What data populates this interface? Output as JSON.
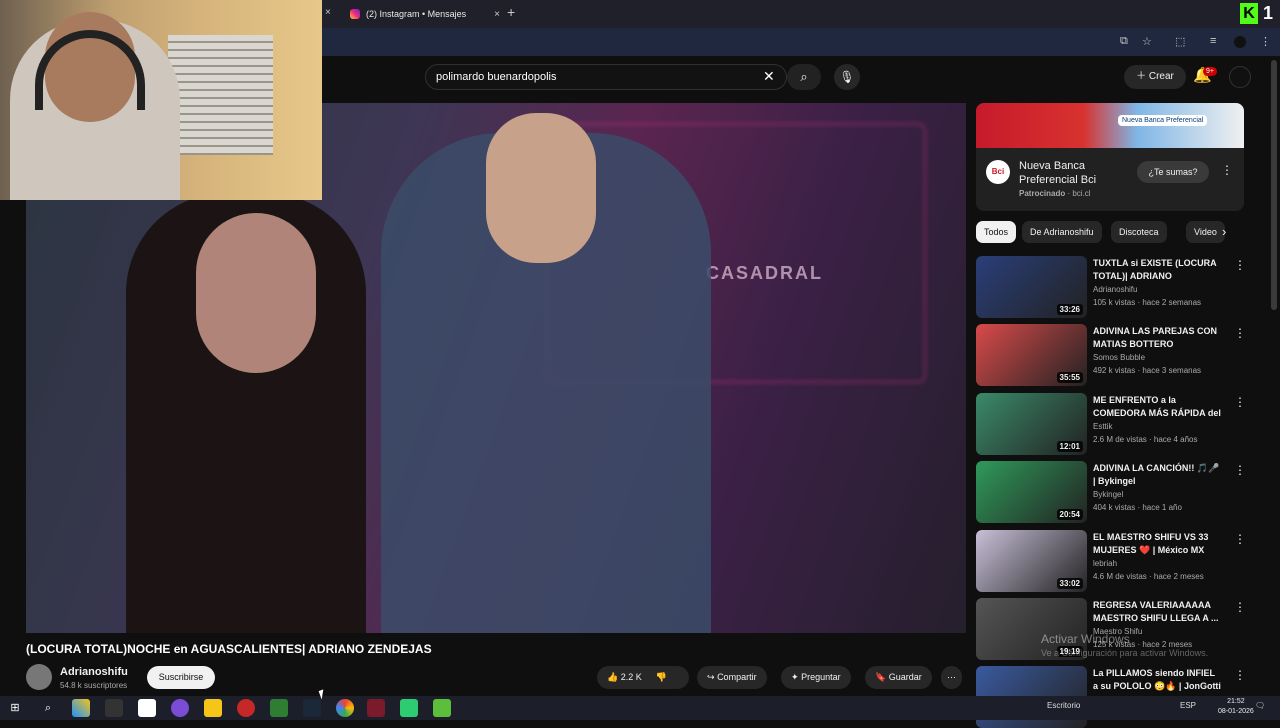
{
  "browser": {
    "tab_title": "(2) Instagram • Mensajes",
    "new_tab_symbol": "+",
    "close_symbol": "×",
    "kick_badge": "K",
    "kick_count": "1"
  },
  "youtube": {
    "search_value": "polimardo buenardopolis",
    "create_label": "Crear",
    "notifications_badge": "9+",
    "video_title": "(LOCURA TOTAL)NOCHE en AGUASCALIENTES| ADRIANO ZENDEJAS",
    "channel_name": "Adrianoshifu",
    "subscribers": "54.8 k suscriptores",
    "subscribe_label": "Suscribirse",
    "likes": "2.2 K",
    "share_label": "Compartir",
    "ask_label": "Preguntar",
    "save_label": "Guardar",
    "video_overlay_text": "CASADRAL"
  },
  "ad": {
    "title": "Nueva Banca Preferencial Bci",
    "sponsored": "Patrocinado",
    "domain": "bci.cl",
    "cta": "¿Te sumas?",
    "logo_text": "Bci",
    "image_caption": "Nueva Banca Preferencial"
  },
  "chips": [
    "Todos",
    "De Adrianoshifu",
    "Discoteca",
    "Video"
  ],
  "recommendations": [
    {
      "title": "TUXTLA si EXISTE (LOCURA TOTAL)| ADRIANO ZENDEJAS",
      "channel": "Adrianoshifu",
      "meta": "105 k vistas · hace 2 semanas",
      "duration": "33:26",
      "color": "#2a3f7a"
    },
    {
      "title": "ADIVINA LAS PAREJAS CON MATIAS BOTTERO",
      "channel": "Somos Bubble",
      "meta": "492 k vistas · hace 3 semanas",
      "duration": "35:55",
      "color": "#d94a4a"
    },
    {
      "title": "ME ENFRENTO a la COMEDORA MÁS RÁPIDA del MUNDO (ELL...",
      "channel": "Esttik",
      "meta": "2.6 M de vistas · hace 4 años",
      "duration": "12:01",
      "color": "#3a8a6a"
    },
    {
      "title": "ADIVINA LA CANCIÓN!! 🎵🎤 | Bykingel",
      "channel": "Bykingel",
      "meta": "404 k vistas · hace 1 año",
      "duration": "20:54",
      "color": "#2f9a5a"
    },
    {
      "title": "EL MAESTRO SHIFU VS 33 MUJERES ❤️ | México MX",
      "channel": "lebriah",
      "meta": "4.6 M de vistas · hace 2 meses",
      "duration": "33:02",
      "color": "#c8c0d8"
    },
    {
      "title": "REGRESA VALERIAAAAAA MAESTRO SHIFU LLEGA A ...",
      "channel": "Maestro Shifu",
      "meta": "125 k vistas · hace 2 meses",
      "duration": "19:19",
      "color": "#555555"
    },
    {
      "title": "La PILLAMOS siendo INFIEL a su POLOLO 😳🔥 | JonGotti CL",
      "channel": "",
      "meta": "",
      "duration": "",
      "color": "#3a5aa0"
    }
  ],
  "windows": {
    "activate_title": "Activar Windows",
    "activate_hint": "Ve a Configuración para activar Windows.",
    "desktop_label": "Escritorio",
    "language": "ESP",
    "time": "21:52",
    "date": "08-01-2026"
  }
}
